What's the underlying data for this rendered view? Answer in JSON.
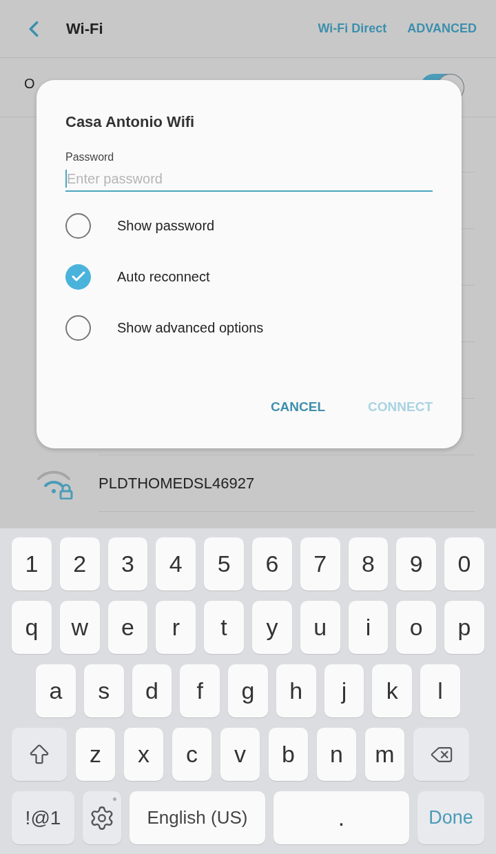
{
  "header": {
    "title": "Wi-Fi",
    "actions": [
      "Wi-Fi Direct",
      "ADVANCED"
    ]
  },
  "master_switch": {
    "label": "O",
    "on": true
  },
  "networks": [
    {
      "name": "PLDTHOMEDSL46927",
      "secured": true
    }
  ],
  "dialog": {
    "title": "Casa Antonio Wifi",
    "field_label": "Password",
    "placeholder": "Enter password",
    "options": [
      {
        "label": "Show password",
        "checked": false
      },
      {
        "label": "Auto reconnect",
        "checked": true
      },
      {
        "label": "Show advanced options",
        "checked": false
      }
    ],
    "buttons": [
      {
        "label": "CANCEL",
        "disabled": false
      },
      {
        "label": "CONNECT",
        "disabled": true
      }
    ]
  },
  "keyboard": {
    "rows": [
      {
        "keys": [
          {
            "kind": "char",
            "label": "1"
          },
          {
            "kind": "char",
            "label": "2"
          },
          {
            "kind": "char",
            "label": "3"
          },
          {
            "kind": "char",
            "label": "4"
          },
          {
            "kind": "char",
            "label": "5"
          },
          {
            "kind": "char",
            "label": "6"
          },
          {
            "kind": "char",
            "label": "7"
          },
          {
            "kind": "char",
            "label": "8"
          },
          {
            "kind": "char",
            "label": "9"
          },
          {
            "kind": "char",
            "label": "0"
          }
        ]
      },
      {
        "keys": [
          {
            "kind": "char",
            "label": "q"
          },
          {
            "kind": "char",
            "label": "w"
          },
          {
            "kind": "char",
            "label": "e"
          },
          {
            "kind": "char",
            "label": "r"
          },
          {
            "kind": "char",
            "label": "t"
          },
          {
            "kind": "char",
            "label": "y"
          },
          {
            "kind": "char",
            "label": "u"
          },
          {
            "kind": "char",
            "label": "i"
          },
          {
            "kind": "char",
            "label": "o"
          },
          {
            "kind": "char",
            "label": "p"
          }
        ]
      },
      {
        "keys": [
          {
            "kind": "char",
            "label": "a"
          },
          {
            "kind": "char",
            "label": "s"
          },
          {
            "kind": "char",
            "label": "d"
          },
          {
            "kind": "char",
            "label": "f"
          },
          {
            "kind": "char",
            "label": "g"
          },
          {
            "kind": "char",
            "label": "h"
          },
          {
            "kind": "char",
            "label": "j"
          },
          {
            "kind": "char",
            "label": "k"
          },
          {
            "kind": "char",
            "label": "l"
          }
        ]
      },
      {
        "keys": [
          {
            "kind": "shift"
          },
          {
            "kind": "char",
            "label": "z"
          },
          {
            "kind": "char",
            "label": "x"
          },
          {
            "kind": "char",
            "label": "c"
          },
          {
            "kind": "char",
            "label": "v"
          },
          {
            "kind": "char",
            "label": "b"
          },
          {
            "kind": "char",
            "label": "n"
          },
          {
            "kind": "char",
            "label": "m"
          },
          {
            "kind": "backspace"
          }
        ]
      },
      {
        "keys": [
          {
            "kind": "symbols",
            "label": "!@1"
          },
          {
            "kind": "settings"
          },
          {
            "kind": "space",
            "label": "English (US)"
          },
          {
            "kind": "char",
            "label": "."
          },
          {
            "kind": "done",
            "label": "Done"
          }
        ]
      }
    ]
  }
}
